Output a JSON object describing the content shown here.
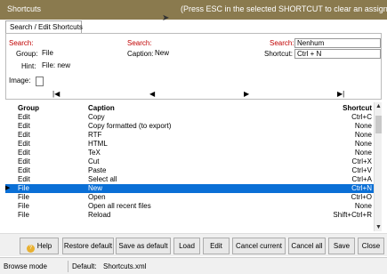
{
  "window": {
    "title": "Shortcuts",
    "hint": "(Press ESC in the selected SHORTCUT to clear an assigned)"
  },
  "tab": {
    "label": "Search / Edit Shortcuts"
  },
  "form": {
    "search1_label": "Search:",
    "search1_value": "",
    "search2_label": "Search:",
    "search2_value": "",
    "search3_label": "Search:",
    "search3_value": "Nenhum",
    "group_label": "Group:",
    "group_value": "File",
    "caption_label": "Caption:",
    "caption_value": "New",
    "shortcut_label": "Shortcut:",
    "shortcut_value": "Ctrl + N",
    "hint_label": "Hint:",
    "hint_value": "File: new",
    "image_label": "Image:"
  },
  "nav": {
    "first": "|◀",
    "prev": "◀",
    "next": "▶",
    "last": "▶|"
  },
  "table": {
    "headers": {
      "group": "Group",
      "caption": "Caption",
      "shortcut": "Shortcut"
    },
    "rows": [
      {
        "group": "Edit",
        "caption": "Copy",
        "shortcut": "Ctrl+C"
      },
      {
        "group": "Edit",
        "caption": "Copy formatted (to export)",
        "shortcut": "None"
      },
      {
        "group": "Edit",
        "caption": "RTF",
        "shortcut": "None"
      },
      {
        "group": "Edit",
        "caption": "HTML",
        "shortcut": "None"
      },
      {
        "group": "Edit",
        "caption": "TeX",
        "shortcut": "None"
      },
      {
        "group": "Edit",
        "caption": "Cut",
        "shortcut": "Ctrl+X"
      },
      {
        "group": "Edit",
        "caption": "Paste",
        "shortcut": "Ctrl+V"
      },
      {
        "group": "Edit",
        "caption": "Select all",
        "shortcut": "Ctrl+A"
      },
      {
        "group": "File",
        "caption": "New",
        "shortcut": "Ctrl+N",
        "selected": true
      },
      {
        "group": "File",
        "caption": "Open",
        "shortcut": "Ctrl+O"
      },
      {
        "group": "File",
        "caption": "Open all recent files",
        "shortcut": "None"
      },
      {
        "group": "File",
        "caption": "Reload",
        "shortcut": "Shift+Ctrl+R"
      }
    ]
  },
  "buttons": {
    "help": "Help",
    "restore_default": "Restore default",
    "save_as_default": "Save as default",
    "load": "Load",
    "edit": "Edit",
    "cancel_current": "Cancel current",
    "cancel_all": "Cancel all",
    "save": "Save",
    "close": "Close"
  },
  "status": {
    "mode": "Browse mode",
    "default_label": "Default:",
    "default_file": "Shortcuts.xml"
  },
  "colors": {
    "titlebar": "#8a7a4e",
    "selection": "#0a6fd6",
    "label_red": "#c00000"
  }
}
